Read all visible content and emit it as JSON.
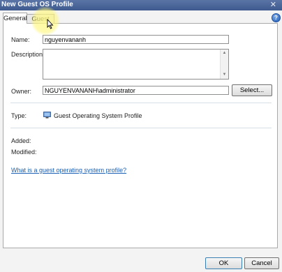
{
  "window": {
    "title": "New Guest OS Profile",
    "close_glyph": "✕",
    "help_glyph": "?"
  },
  "tabs": [
    {
      "label": "General",
      "active": true
    },
    {
      "label": "Guest OS",
      "active": false
    }
  ],
  "form": {
    "name_label": "Name:",
    "name_value": "nguyenvananh",
    "description_label": "Description:",
    "description_value": "",
    "owner_label": "Owner:",
    "owner_value": "NGUYENVANANH\\administrator",
    "select_button": "Select...",
    "type_label": "Type:",
    "type_value": "Guest Operating System Profile",
    "type_icon": "monitor-icon",
    "added_label": "Added:",
    "added_value": "",
    "modified_label": "Modified:",
    "modified_value": "",
    "help_link": "What is a guest operating system profile?"
  },
  "footer": {
    "ok": "OK",
    "cancel": "Cancel"
  },
  "colors": {
    "titlebar": "#3e5a8e",
    "link": "#1a5fb4",
    "highlight": "#fff68c"
  }
}
